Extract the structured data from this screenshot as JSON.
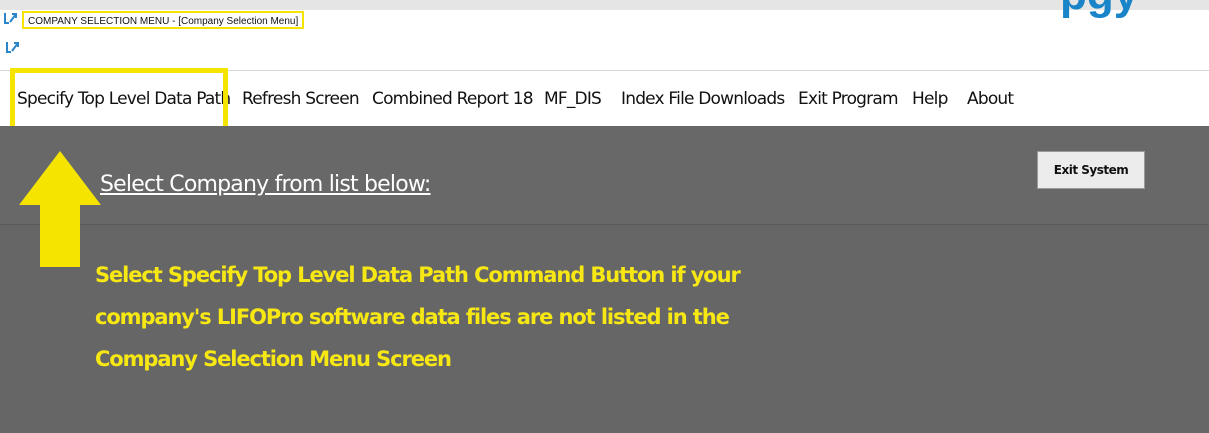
{
  "window": {
    "title": "COMPANY SELECTION MENU - [Company Selection Menu]",
    "corner_partial_text": "pgy"
  },
  "menu": {
    "items": [
      {
        "label": "Specify Top Level Data Path"
      },
      {
        "label": "Refresh Screen"
      },
      {
        "label": "Combined Report 18"
      },
      {
        "label": "MF_DIS"
      },
      {
        "label": "Index File Downloads"
      },
      {
        "label": "Exit Program"
      },
      {
        "label": "Help"
      },
      {
        "label": "About"
      }
    ]
  },
  "main": {
    "select_label": "Select Company from list below:",
    "exit_button": "Exit System",
    "annotation_lines": [
      "Select Specify Top Level Data Path Command Button if your",
      "company's LIFOPro software data files are not listed in the",
      "Company Selection Menu Screen"
    ]
  },
  "colors": {
    "highlight": "#f4e400",
    "content_bg": "#666666",
    "annotation_text": "#f7e814"
  },
  "icons": [
    "app-logo-icon",
    "up-arrow-icon"
  ]
}
